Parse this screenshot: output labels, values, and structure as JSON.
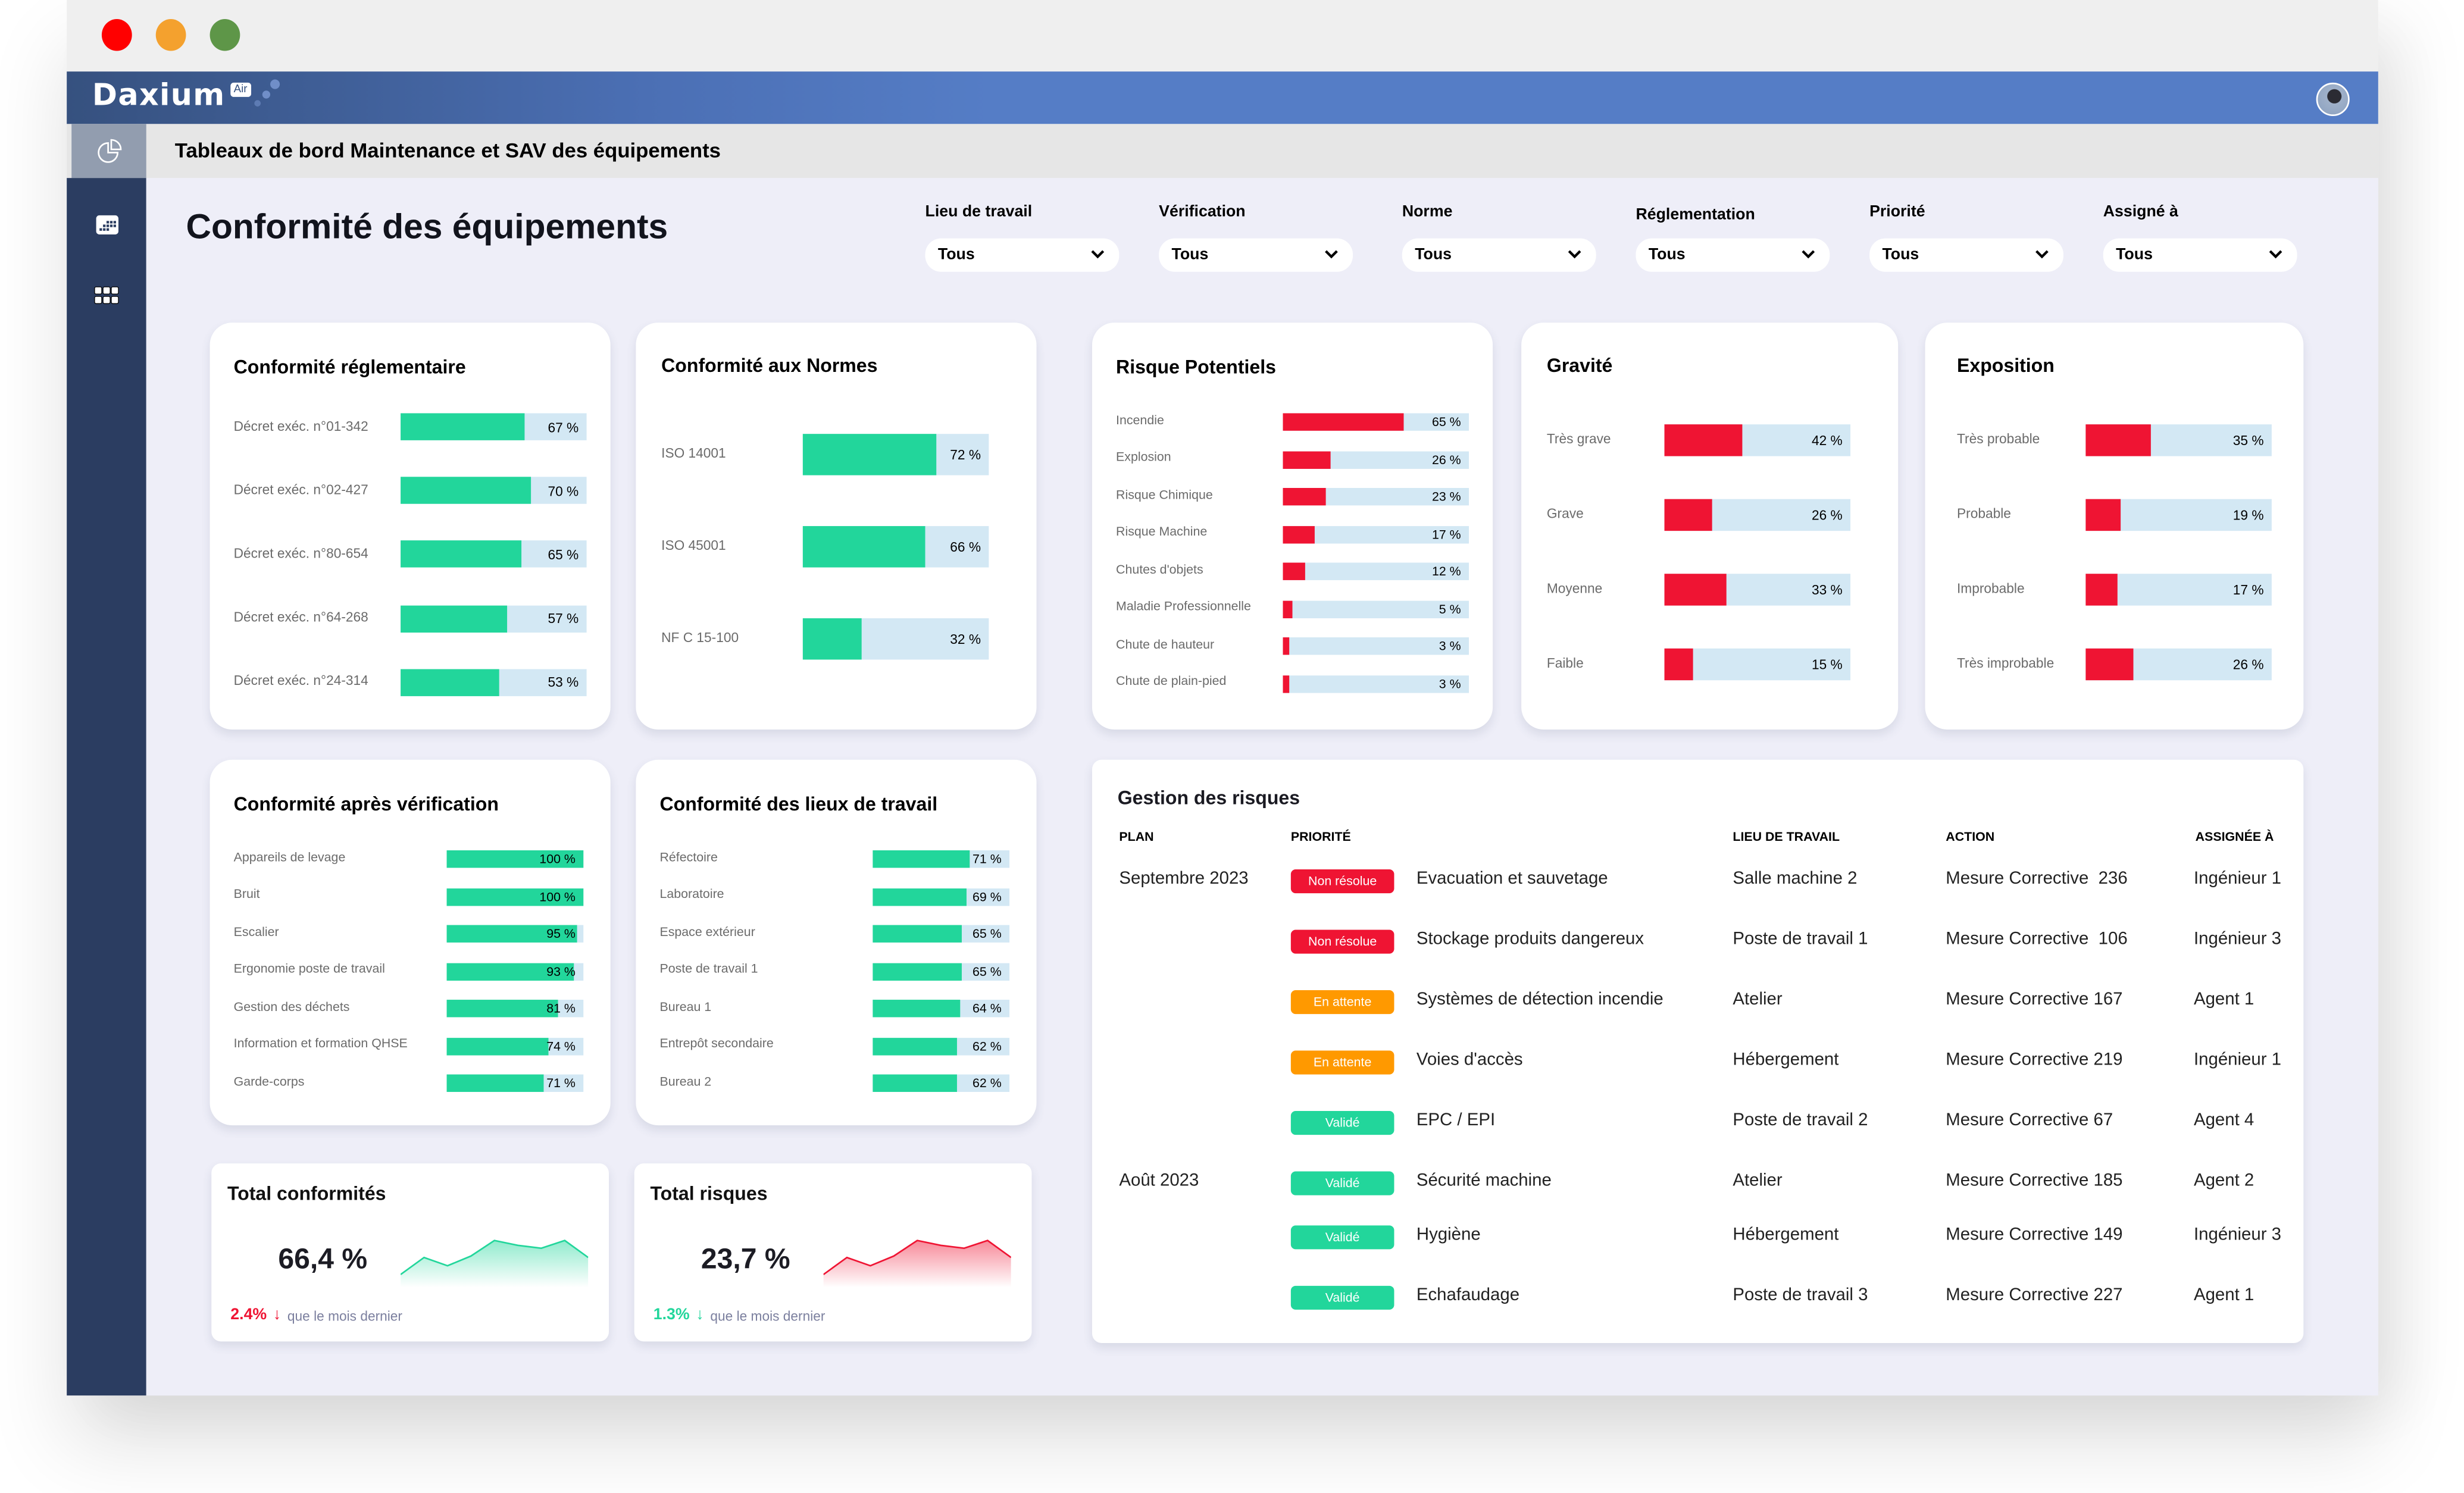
{
  "window": {
    "controls": [
      {
        "name": "close",
        "color": "#ff0000"
      },
      {
        "name": "minimize",
        "color": "#f4a12e"
      },
      {
        "name": "maximize",
        "color": "#5e9648"
      }
    ]
  },
  "app": {
    "logo_text": "Daxium",
    "logo_badge": "Air",
    "avatar": "user-avatar"
  },
  "breadcrumb": {
    "icon": "pie-chart-icon",
    "title": "Tableaux de bord Maintenance et SAV des équipements"
  },
  "sidebar": {
    "items": [
      {
        "icon": "pie-chart-icon",
        "active": true
      },
      {
        "icon": "calendar-icon",
        "active": false
      },
      {
        "icon": "grid-icon",
        "active": false
      }
    ]
  },
  "page": {
    "title": "Conformité des équipements"
  },
  "filters": [
    {
      "label": "Lieu de travail",
      "value": "Tous"
    },
    {
      "label": "Vérification",
      "value": "Tous"
    },
    {
      "label": "Norme",
      "value": "Tous"
    },
    {
      "label": "Réglementation",
      "value": "Tous"
    },
    {
      "label": "Priorité",
      "value": "Tous"
    },
    {
      "label": "Assigné à",
      "value": "Tous"
    }
  ],
  "colors": {
    "green": "#22d69b",
    "red": "#ef1433",
    "track": "#d3e8f4",
    "orange": "#ff9900",
    "appbar": "#557dc6",
    "sidebar": "#2b3d61"
  },
  "chart_data": [
    {
      "id": "conformite-reglementaire",
      "type": "bar",
      "title": "Conformité réglementaire",
      "color": "green",
      "categories": [
        "Décret exéc. n°01-342",
        "Décret exéc. n°02-427",
        "Décret exéc. n°80-654",
        "Décret exéc. n°64-268",
        "Décret exéc. n°24-314"
      ],
      "values": [
        67,
        70,
        65,
        57,
        53
      ],
      "labels": [
        "67 %",
        "70 %",
        "65 %",
        "57 %",
        "53 %"
      ],
      "ylim": [
        0,
        100
      ]
    },
    {
      "id": "conformite-normes",
      "type": "bar",
      "title": "Conformité aux Normes",
      "color": "green",
      "categories": [
        "ISO 14001",
        "ISO 45001",
        "NF C 15-100"
      ],
      "values": [
        72,
        66,
        32
      ],
      "labels": [
        "72 %",
        "66 %",
        "32 %"
      ],
      "ylim": [
        0,
        100
      ]
    },
    {
      "id": "risques-potentiels",
      "type": "bar",
      "title": "Risque Potentiels",
      "color": "red",
      "categories": [
        "Incendie",
        "Explosion",
        "Risque Chimique",
        "Risque Machine",
        "Chutes d'objets",
        "Maladie Professionnelle",
        "Chute de hauteur",
        "Chute de plain-pied"
      ],
      "values": [
        65,
        26,
        23,
        17,
        12,
        5,
        3,
        3
      ],
      "labels": [
        "65 %",
        "26 %",
        "23 %",
        "17 %",
        "12 %",
        "5 %",
        "3 %",
        "3 %"
      ],
      "ylim": [
        0,
        100
      ]
    },
    {
      "id": "gravite",
      "type": "bar",
      "title": "Gravité",
      "color": "red",
      "categories": [
        "Très grave",
        "Grave",
        "Moyenne",
        "Faible"
      ],
      "values": [
        42,
        26,
        33,
        15
      ],
      "labels": [
        "42 %",
        "26 %",
        "33 %",
        "15 %"
      ],
      "ylim": [
        0,
        100
      ]
    },
    {
      "id": "exposition",
      "type": "bar",
      "title": "Exposition",
      "color": "red",
      "categories": [
        "Très probable",
        "Probable",
        "Improbable",
        "Très improbable"
      ],
      "values": [
        35,
        19,
        17,
        26
      ],
      "labels": [
        "35 %",
        "19 %",
        "17 %",
        "26 %"
      ],
      "ylim": [
        0,
        100
      ]
    },
    {
      "id": "conformite-verification",
      "type": "bar",
      "title": "Conformité après vérification",
      "color": "green",
      "categories": [
        "Appareils de levage",
        "Bruit",
        "Escalier",
        "Ergonomie poste de travail",
        "Gestion des déchets",
        "Information et formation QHSE",
        "Garde-corps"
      ],
      "values": [
        100,
        100,
        95,
        93,
        81,
        74,
        71
      ],
      "labels": [
        "100 %",
        "100 %",
        "95 %",
        "93 %",
        "81 %",
        "74 %",
        "71 %"
      ],
      "ylim": [
        0,
        100
      ]
    },
    {
      "id": "conformite-lieux",
      "type": "bar",
      "title": "Conformité des lieux de travail",
      "color": "green",
      "categories": [
        "Réfectoire",
        "Laboratoire",
        "Espace extérieur",
        "Poste de travail 1",
        "Bureau 1",
        "Entrepôt secondaire",
        "Bureau 2"
      ],
      "values": [
        71,
        69,
        65,
        65,
        64,
        62,
        62
      ],
      "labels": [
        "71 %",
        "69 %",
        "65 %",
        "65 %",
        "64 %",
        "62 %",
        "62 %"
      ],
      "ylim": [
        0,
        100
      ]
    },
    {
      "id": "total-conformites-trend",
      "type": "area",
      "title": "Total conformités",
      "color": "green",
      "values": [
        20,
        55,
        38,
        58,
        90,
        80,
        74,
        90,
        55
      ],
      "ylim": [
        0,
        100
      ]
    },
    {
      "id": "total-risques-trend",
      "type": "area",
      "title": "Total risques",
      "color": "red",
      "values": [
        20,
        55,
        38,
        58,
        90,
        80,
        74,
        90,
        55
      ],
      "ylim": [
        0,
        100
      ]
    }
  ],
  "totals": {
    "conformites": {
      "title": "Total conformités",
      "value": "66,4 %",
      "delta": "2.4%",
      "delta_direction": "down",
      "delta_color": "#ef1433",
      "sub": "que le mois dernier"
    },
    "risques": {
      "title": "Total risques",
      "value": "23,7 %",
      "delta": "1.3%",
      "delta_direction": "down",
      "delta_color": "#22d69b",
      "sub": "que le mois dernier"
    }
  },
  "risk_table": {
    "title": "Gestion des risques",
    "headers": {
      "plan": "PLAN",
      "priority": "PRIORITÉ",
      "location": "LIEU DE TRAVAIL",
      "action": "ACTION",
      "assigned": "ASSIGNÉE À"
    },
    "status_colors": {
      "Non résolue": "#ef1433",
      "En attente": "#ff9900",
      "Validé": "#22d69b"
    },
    "rows": [
      {
        "plan": "Septembre 2023",
        "status": "Non résolue",
        "item": "Evacuation et sauvetage",
        "location": "Salle machine 2",
        "action": "Mesure Corrective  236",
        "assigned": "Ingénieur 1"
      },
      {
        "plan": "",
        "status": "Non résolue",
        "item": "Stockage produits dangereux",
        "location": "Poste de travail 1",
        "action": "Mesure Corrective  106",
        "assigned": "Ingénieur 3"
      },
      {
        "plan": "",
        "status": "En attente",
        "item": "Systèmes de détection incendie",
        "location": "Atelier",
        "action": "Mesure Corrective 167",
        "assigned": "Agent 1"
      },
      {
        "plan": "",
        "status": "En attente",
        "item": "Voies d'accès",
        "location": "Hébergement",
        "action": "Mesure Corrective 219",
        "assigned": "Ingénieur 1"
      },
      {
        "plan": "",
        "status": "Validé",
        "item": "EPC / EPI",
        "location": "Poste de travail 2",
        "action": "Mesure Corrective 67",
        "assigned": "Agent 4"
      },
      {
        "plan": "Août 2023",
        "status": "Validé",
        "item": "Sécurité machine",
        "location": "Atelier",
        "action": "Mesure Corrective 185",
        "assigned": "Agent 2"
      },
      {
        "plan": "",
        "status": "Validé",
        "item": "Hygiène",
        "location": "Hébergement",
        "action": "Mesure Corrective 149",
        "assigned": "Ingénieur 3"
      },
      {
        "plan": "",
        "status": "Validé",
        "item": "Echafaudage",
        "location": "Poste de travail 3",
        "action": "Mesure Corrective 227",
        "assigned": "Agent 1"
      }
    ]
  }
}
